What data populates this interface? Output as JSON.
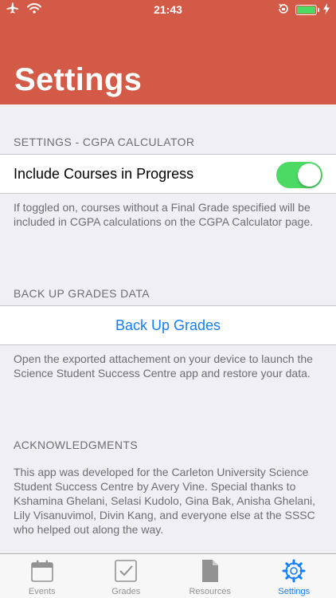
{
  "status_bar": {
    "time": "21:43",
    "battery_color": "#4cd964"
  },
  "nav": {
    "title": "Settings",
    "background": "#d35a47"
  },
  "sections": {
    "cgpa": {
      "header": "SETTINGS - CGPA CALCULATOR",
      "toggle_label": "Include Courses in Progress",
      "toggle_on": true,
      "footer": "If toggled on, courses without a Final Grade specified will be included in CGPA calculations on the CGPA Calculator page."
    },
    "backup": {
      "header": "BACK UP GRADES DATA",
      "button_label": "Back Up Grades",
      "footer": "Open the exported attachement on your device to launch the Science Student Success Centre app and restore your data."
    },
    "acknowledgments": {
      "header": "ACKNOWLEDGMENTS",
      "body": "This app was developed for the Carleton University Science Student Success Centre by Avery Vine. Special thanks to Kshamina Ghelani, Selasi Kudolo, Gina Bak, Anisha Ghelani, Lily Visanuvimol, Divin Kang, and everyone else at the SSSC who helped out along the way."
    }
  },
  "tabs": [
    {
      "label": "Events",
      "icon": "calendar-icon",
      "active": false
    },
    {
      "label": "Grades",
      "icon": "checkbox-icon",
      "active": false
    },
    {
      "label": "Resources",
      "icon": "document-icon",
      "active": false
    },
    {
      "label": "Settings",
      "icon": "gear-icon",
      "active": true
    }
  ],
  "colors": {
    "accent": "#157efb",
    "toggle_on": "#4cd964",
    "tab_inactive": "#929292"
  }
}
